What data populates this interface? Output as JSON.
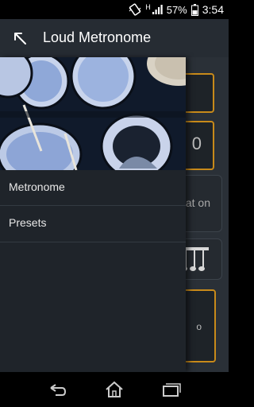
{
  "status_bar": {
    "battery_percent": "57%",
    "time": "3:54",
    "network_label": "H"
  },
  "action_bar": {
    "title": "Loud Metronome"
  },
  "drawer": {
    "items": [
      {
        "label": "Metronome"
      },
      {
        "label": "Presets"
      }
    ]
  },
  "background": {
    "card_value": "0",
    "pill_text": "at on",
    "card_text": "o"
  },
  "colors": {
    "accent": "#c88a1a",
    "drawer_bg": "#1f242a",
    "actionbar_bg": "#262c33"
  },
  "icons": [
    "back-arrow-icon",
    "vibrate-icon",
    "signal-icon",
    "battery-icon",
    "nav-back-icon",
    "nav-home-icon",
    "nav-recents-icon"
  ]
}
